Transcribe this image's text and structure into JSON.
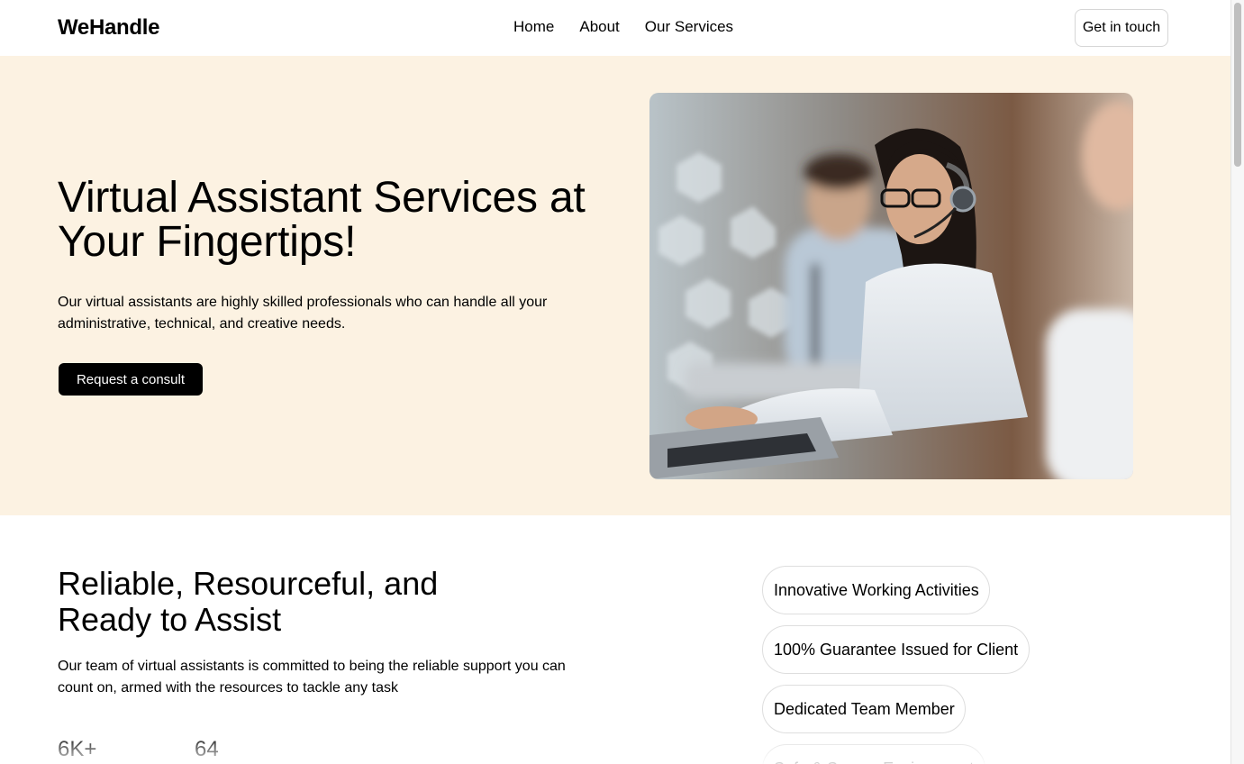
{
  "nav": {
    "logo": "WeHandle",
    "links": [
      "Home",
      "About",
      "Our Services"
    ],
    "cta": "Get in touch"
  },
  "hero": {
    "title_line1": "Virtual Assistant Services at",
    "title_line2": "Your Fingertips!",
    "description": "Our virtual assistants are highly skilled professionals who can handle all your administrative, technical, and creative needs.",
    "button": "Request a consult",
    "image_icon": "call-center-photo",
    "background_color": "#fcf2e2"
  },
  "section2": {
    "title_line1": "Reliable, Resourceful, and",
    "title_line2": "Ready to Assist",
    "description": "Our team of virtual assistants is committed to being the reliable support you can count on, armed with the resources to tackle any task",
    "stats": [
      "6K+",
      "64"
    ],
    "features": [
      "Innovative Working Activities",
      "100% Guarantee Issued for Client",
      "Dedicated Team Member",
      "Safe & Secure Environment"
    ]
  },
  "colors": {
    "accent": "#000000",
    "hero_bg": "#fcf2e2"
  }
}
